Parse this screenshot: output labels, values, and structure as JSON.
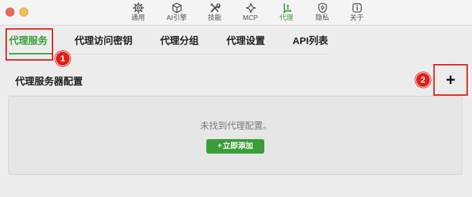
{
  "toolbar": {
    "items": [
      {
        "label": "通用",
        "icon": "gear-icon"
      },
      {
        "label": "AI引擎",
        "icon": "cube-icon"
      },
      {
        "label": "技能",
        "icon": "tools-icon"
      },
      {
        "label": "MCP",
        "icon": "sparkle-icon"
      },
      {
        "label": "代理",
        "icon": "proxy-icon",
        "active": true
      },
      {
        "label": "隐私",
        "icon": "shield-icon"
      },
      {
        "label": "关于",
        "icon": "info-icon"
      }
    ],
    "active_color": "#3a9d3a"
  },
  "tabs": [
    {
      "label": "代理服务",
      "active": true
    },
    {
      "label": "代理访问密钥"
    },
    {
      "label": "代理分组"
    },
    {
      "label": "代理设置"
    },
    {
      "label": "API列表"
    }
  ],
  "annotations": {
    "badge_1": "1",
    "badge_2": "2",
    "color": "#e0201b"
  },
  "section": {
    "title": "代理服务器配置",
    "add_symbol": "+"
  },
  "empty_state": {
    "message": "未找到代理配置。",
    "button_label": "立即添加",
    "button_plus": "+"
  }
}
